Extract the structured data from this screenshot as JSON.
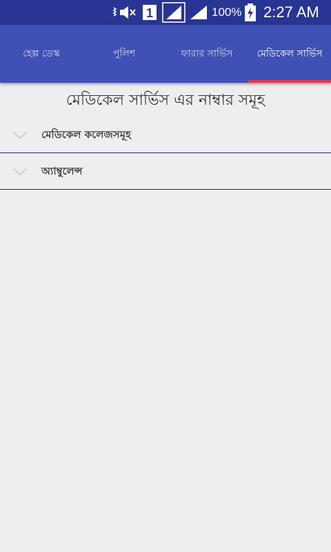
{
  "status_bar": {
    "battery_percent": "100%",
    "time": "2:27 AM",
    "sim_slot": "1",
    "icons": [
      "vibrate-icon",
      "sim-slot-icon",
      "signal-icon",
      "signal-icon",
      "battery-charging-icon"
    ]
  },
  "tabs": [
    {
      "label": "হেল্প ডেস্ক",
      "active": false
    },
    {
      "label": "পুলিশ",
      "active": false
    },
    {
      "label": "ফারার সার্ভিস",
      "active": false
    },
    {
      "label": "মেডিকেল সার্ভিস",
      "active": true
    }
  ],
  "main": {
    "title": "মেডিকেল সার্ভিস এর নাম্বার সমূহ",
    "items": [
      {
        "label": "মেডিকেল কলেজসমূহ",
        "icon": "chevron-down-icon"
      },
      {
        "label": "অ্যাম্বুলেন্স",
        "icon": "chevron-down-icon"
      }
    ]
  },
  "colors": {
    "status_bar": "#283593",
    "app_bar": "#3f51b5",
    "tab_indicator": "#e53950",
    "background": "#eeeeee",
    "divider": "#1f2f66"
  }
}
